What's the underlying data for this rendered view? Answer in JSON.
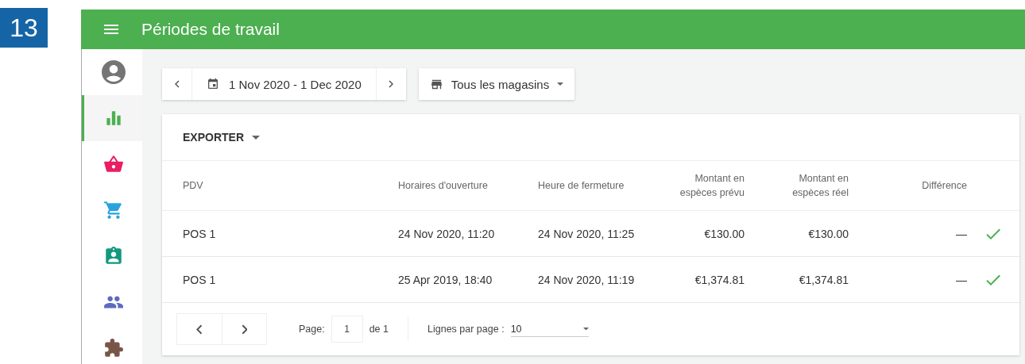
{
  "step_badge": "13",
  "app_bar": {
    "title": "Périodes de travail"
  },
  "sidebar": {
    "items": [
      {
        "kind": "profile",
        "selected": false,
        "color": "#757575"
      },
      {
        "kind": "chart",
        "selected": true,
        "color": "#4caf50"
      },
      {
        "kind": "basket",
        "selected": false,
        "color": "#e91e63"
      },
      {
        "kind": "cart",
        "selected": false,
        "color": "#29a3e0"
      },
      {
        "kind": "card",
        "selected": false,
        "color": "#13987e"
      },
      {
        "kind": "people",
        "selected": false,
        "color": "#5c6bc0"
      },
      {
        "kind": "puzzle",
        "selected": false,
        "color": "#795548"
      }
    ]
  },
  "date_range": "1 Nov 2020 - 1 Dec 2020",
  "store_filter": "Tous les magasins",
  "export_button": "EXPORTER",
  "table": {
    "columns": [
      "PDV",
      "Horaires d'ouverture",
      "Heure de fermeture",
      "Montant en espèces prévu",
      "Montant en espèces réel",
      "Différence"
    ],
    "rows": [
      {
        "cells": [
          "POS 1",
          "24 Nov 2020, 11:20",
          "24 Nov 2020, 11:25",
          "€130.00",
          "€130.00",
          "—"
        ],
        "ok": true
      },
      {
        "cells": [
          "POS 1",
          "25 Apr 2019, 18:40",
          "24 Nov 2020, 11:19",
          "€1,374.81",
          "€1,374.81",
          "—"
        ],
        "ok": true
      }
    ]
  },
  "pagination": {
    "page_label": "Page:",
    "page": "1",
    "of_label": "de 1",
    "rows_label": "Lignes par page :",
    "rows_value": "10"
  }
}
